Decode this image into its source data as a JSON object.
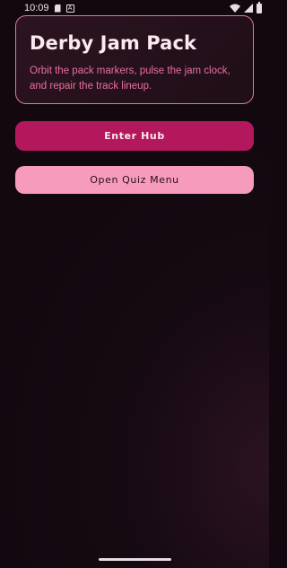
{
  "status_bar": {
    "time": "10:09",
    "icons": [
      "sd-card-icon",
      "a-icon",
      "wifi-icon",
      "signal-icon",
      "battery-icon"
    ]
  },
  "header": {
    "title": "Derby Jam Pack",
    "subtitle": "Orbit the pack markers, pulse the jam clock, and repair the track lineup."
  },
  "actions": {
    "primary_label": "Enter Hub",
    "secondary_label": "Open Quiz Menu"
  },
  "colors": {
    "background": "#12080e",
    "card_border": "#d87aa4",
    "accent": "#ea6fa3",
    "primary_button": "#b3185c",
    "secondary_button": "#f79bbd"
  }
}
